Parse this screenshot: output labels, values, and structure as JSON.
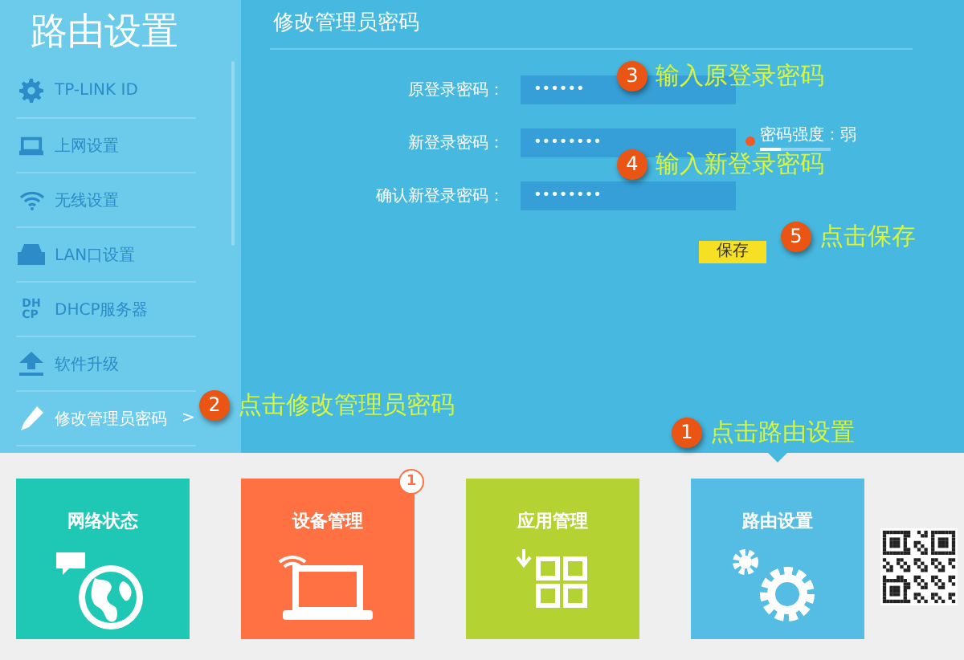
{
  "sidebar": {
    "title": "路由设置",
    "items": [
      {
        "label": "TP-LINK ID",
        "selected": false
      },
      {
        "label": "上网设置",
        "selected": false
      },
      {
        "label": "无线设置",
        "selected": false
      },
      {
        "label": "LAN口设置",
        "selected": false
      },
      {
        "icon_text": [
          "DH",
          "CP"
        ],
        "label": "DHCP服务器",
        "selected": false
      },
      {
        "label": "软件升级",
        "selected": false
      },
      {
        "label": "修改管理员密码",
        "selected": true,
        "arrow": ">"
      }
    ]
  },
  "panel": {
    "title": "修改管理员密码",
    "fields": [
      {
        "label": "原登录密码：",
        "value": "••••••"
      },
      {
        "label": "新登录密码：",
        "value": "••••••••",
        "strength": {
          "label": "密码强度：弱",
          "level": 0.3
        }
      },
      {
        "label": "确认新登录密码：",
        "value": "••••••••"
      }
    ],
    "save_button": "保存"
  },
  "tiles": [
    {
      "label": "网络状态",
      "color": "#1ec8b4",
      "selected": false
    },
    {
      "label": "设备管理",
      "color": "#ff7043",
      "badge": "1",
      "selected": false
    },
    {
      "label": "应用管理",
      "color": "#b5d233",
      "selected": false
    },
    {
      "label": "路由设置",
      "color": "#55bde3",
      "selected": true
    }
  ],
  "annotations": [
    {
      "number": "1",
      "text": "点击路由设置"
    },
    {
      "number": "2",
      "text": "点击修改管理员密码"
    },
    {
      "number": "3",
      "text": "输入原登录密码"
    },
    {
      "number": "4",
      "text": "输入新登录密码"
    },
    {
      "number": "5",
      "text": "点击保存"
    }
  ]
}
